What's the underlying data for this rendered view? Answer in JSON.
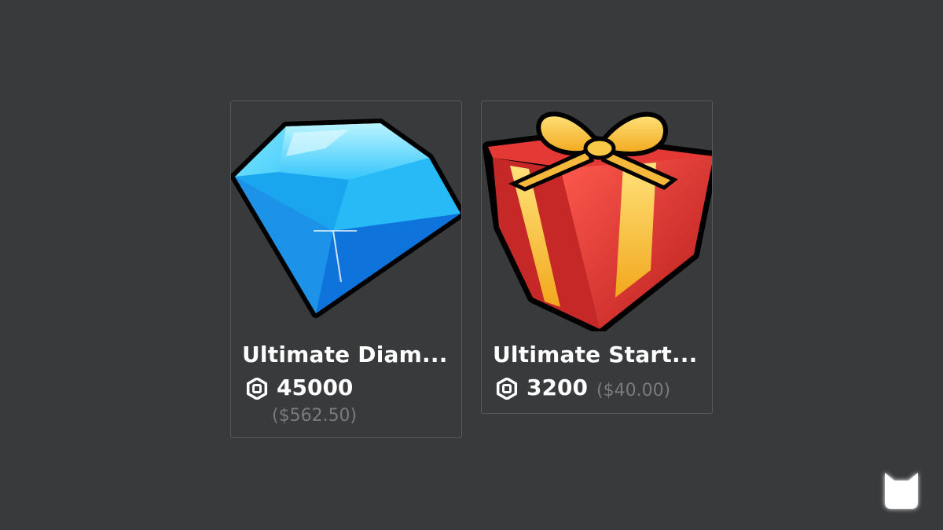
{
  "store": {
    "items": [
      {
        "name": "Ultimate Diam...",
        "price": "45000",
        "usd": "($562.50)",
        "thumbnail": "diamond-icon",
        "currency_icon": "robux-icon"
      },
      {
        "name": "Ultimate Start...",
        "price": "3200",
        "usd": "($40.00)",
        "thumbnail": "gift-box-icon",
        "currency_icon": "robux-icon"
      }
    ]
  },
  "colors": {
    "background": "#393a3c",
    "card_border": "#58595b",
    "text": "#ffffff",
    "muted_text": "#7a7b7d",
    "diamond": "#29b6f6",
    "gift_box": "#d32f2f",
    "ribbon": "#fbc02d"
  },
  "corner_logo": "cat-logo-icon"
}
